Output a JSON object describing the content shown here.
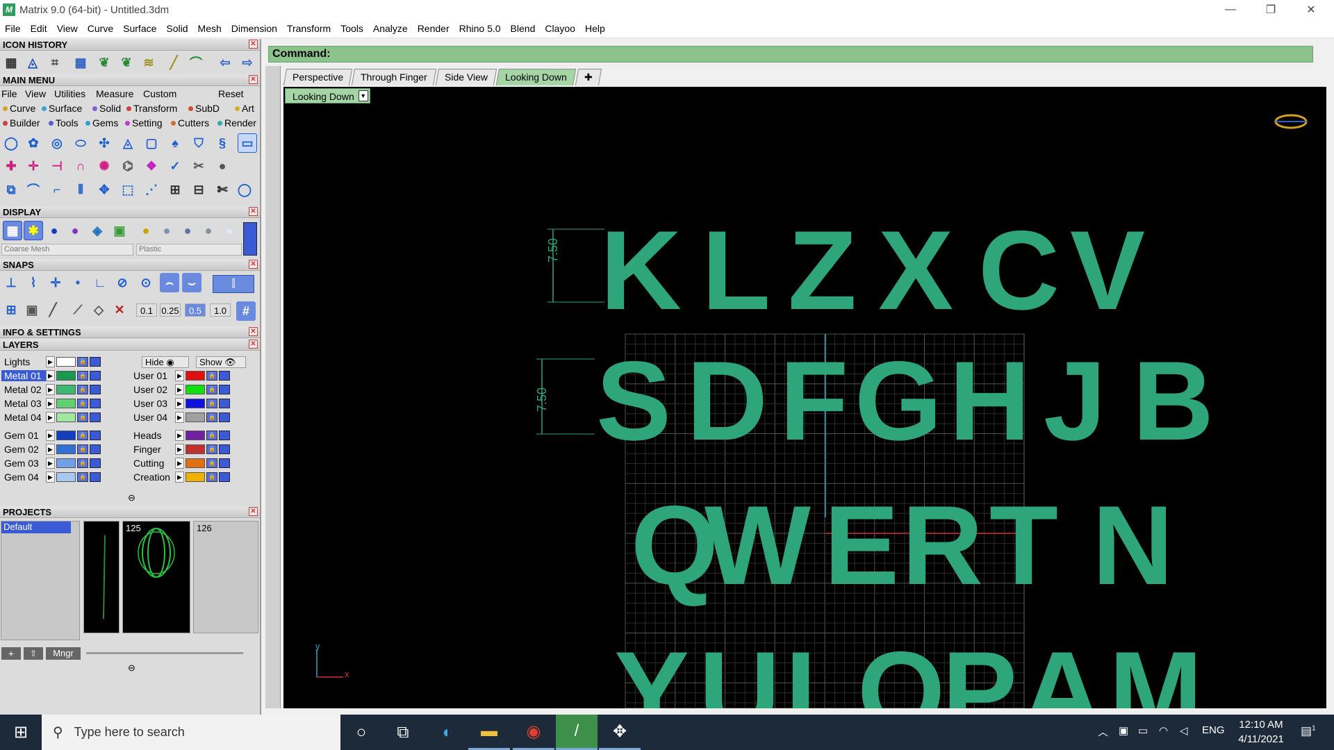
{
  "window": {
    "title": "Matrix 9.0 (64-bit) - Untitled.3dm",
    "app_icon": "M"
  },
  "menubar": [
    "File",
    "Edit",
    "View",
    "Curve",
    "Surface",
    "Solid",
    "Mesh",
    "Dimension",
    "Transform",
    "Tools",
    "Analyze",
    "Render",
    "Rhino 5.0",
    "Blend",
    "Clayoo",
    "Help"
  ],
  "left": {
    "icon_history": "ICON HISTORY",
    "main_menu": {
      "title": "MAIN MENU",
      "menus": [
        "File",
        "View",
        "Utilities",
        "Measure",
        "Custom"
      ],
      "reset": "Reset",
      "row1": [
        {
          "label": "Curve",
          "color": "#d8a030"
        },
        {
          "label": "Surface",
          "color": "#40a0d0"
        },
        {
          "label": "Solid",
          "color": "#8060d0"
        },
        {
          "label": "Transform",
          "color": "#d04040"
        },
        {
          "label": "SubD",
          "color": "#d05030"
        },
        {
          "label": "Art",
          "color": "#d0b020"
        }
      ],
      "row2": [
        {
          "label": "Builder",
          "color": "#d04040"
        },
        {
          "label": "Tools",
          "color": "#5060d0"
        },
        {
          "label": "Gems",
          "color": "#30a0d0"
        },
        {
          "label": "Setting",
          "color": "#c040c0"
        },
        {
          "label": "Cutters",
          "color": "#d07030"
        },
        {
          "label": "Render",
          "color": "#30b0a0"
        }
      ]
    },
    "display": {
      "title": "DISPLAY",
      "mesh": "Coarse Mesh",
      "material": "Plastic"
    },
    "snaps": {
      "title": "SNAPS",
      "values": [
        "0.1",
        "0.25",
        "0.5",
        "1.0"
      ]
    },
    "info": "INFO & SETTINGS",
    "layers": {
      "title": "LAYERS",
      "lights": "Lights",
      "hide": "Hide",
      "show": "Show",
      "left_col": [
        {
          "name": "Metal 01",
          "color": "#1a9a50",
          "selected": true
        },
        {
          "name": "Metal 02",
          "color": "#3cb870"
        },
        {
          "name": "Metal 03",
          "color": "#60d070"
        },
        {
          "name": "Metal 04",
          "color": "#a0e8a0"
        },
        {
          "name": "Gem 01",
          "color": "#1040c0"
        },
        {
          "name": "Gem 02",
          "color": "#3070d0"
        },
        {
          "name": "Gem 03",
          "color": "#70a0e8"
        },
        {
          "name": "Gem 04",
          "color": "#a8c8f0"
        }
      ],
      "right_col": [
        {
          "name": "User 01",
          "color": "#e01010"
        },
        {
          "name": "User 02",
          "color": "#10e010"
        },
        {
          "name": "User 03",
          "color": "#1010e0"
        },
        {
          "name": "User 04",
          "color": "#a0a0a0"
        },
        {
          "name": "Heads",
          "color": "#7020a0"
        },
        {
          "name": "Finger",
          "color": "#c03030"
        },
        {
          "name": "Cutting",
          "color": "#e07010"
        },
        {
          "name": "Creation",
          "color": "#f0b000"
        }
      ]
    },
    "projects": {
      "title": "PROJECTS",
      "default": "Default",
      "thumb1": "125",
      "thumb2": "126",
      "mngr": "Mngr"
    }
  },
  "command": {
    "label": "Command:"
  },
  "tabs": [
    "Perspective",
    "Through Finger",
    "Side View",
    "Looking Down"
  ],
  "active_tab": "Looking Down",
  "viewport": {
    "label": "Looking Down",
    "dim1": "7.50",
    "dim2": "7.50",
    "row1": [
      "K",
      "L",
      "Z",
      "X",
      "C",
      "V"
    ],
    "row2": [
      "S",
      "D",
      "F",
      "G",
      "H",
      "J",
      "B"
    ],
    "row3": [
      "Q",
      "W",
      "E",
      "R",
      "T",
      "N"
    ],
    "row4": [
      "Y",
      "U",
      "I",
      "O",
      "P",
      "A",
      "M"
    ],
    "axis_y": "y",
    "axis_x": "x",
    "letter_color": "#2fa57c"
  },
  "taskbar": {
    "search_placeholder": "Type here to search",
    "lang": "ENG",
    "time": "12:10 AM",
    "date": "4/11/2021",
    "notif_count": "1"
  }
}
